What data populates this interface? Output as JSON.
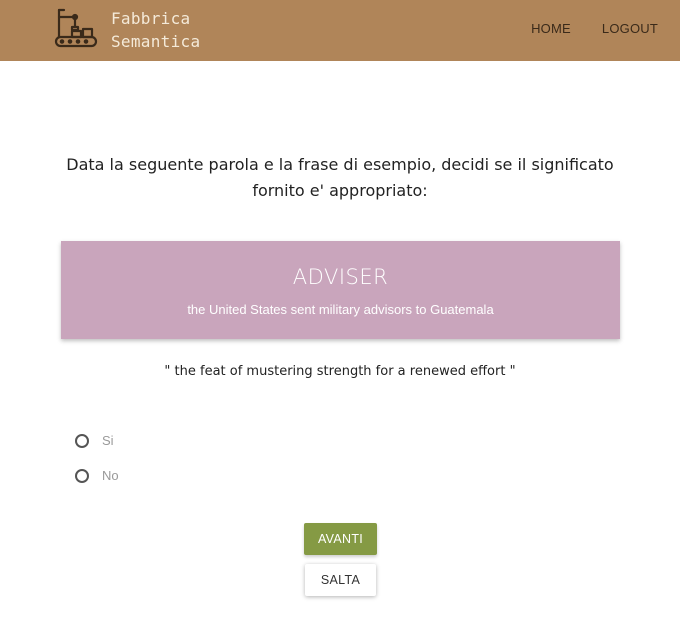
{
  "header": {
    "brand_line1": "Fabbrica",
    "brand_line2": "Semantica",
    "logo_icon": "robot-arm-conveyor-icon",
    "nav": {
      "home": "HOME",
      "logout": "LOGOUT"
    }
  },
  "main": {
    "question": "Data la seguente parola e la frase di esempio, decidi se il significato fornito e' appropriato:",
    "word": "ADVISER",
    "example": "the United States sent military advisors to Guatemala",
    "definition": "\" the feat of mustering strength for a renewed effort \"",
    "options": [
      {
        "label": "Si",
        "selected": false
      },
      {
        "label": "No",
        "selected": false
      }
    ],
    "buttons": {
      "next": "AVANTI",
      "skip": "SALTA"
    }
  },
  "colors": {
    "navbar": "#b08559",
    "card": "#c9a5bc",
    "next_button": "#859a44"
  }
}
